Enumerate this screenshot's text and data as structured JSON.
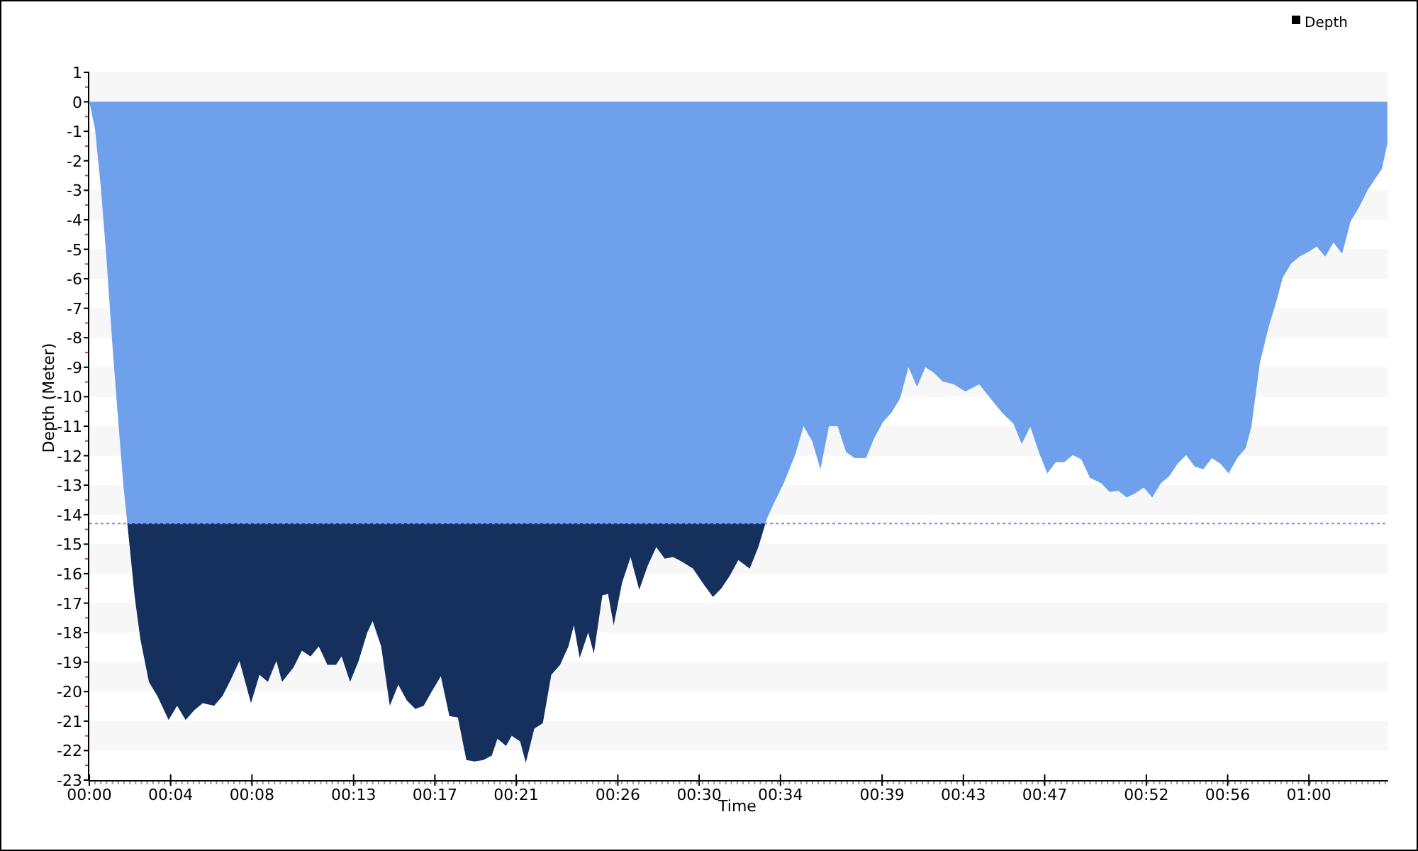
{
  "chart": {
    "chart_data": {
      "type": "area",
      "xlabel": "Time",
      "ylabel": "Depth (Meter)",
      "x": [
        0,
        0.28,
        0.56,
        0.84,
        1.12,
        1.39,
        1.67,
        1.95,
        2.23,
        2.51,
        2.93,
        3.35,
        3.9,
        4.32,
        4.74,
        5.16,
        5.58,
        6.14,
        6.55,
        6.97,
        7.39,
        7.95,
        8.37,
        8.78,
        9.2,
        9.48,
        10.04,
        10.46,
        10.88,
        11.29,
        11.71,
        12.13,
        12.41,
        12.83,
        13.25,
        13.67,
        13.94,
        14.36,
        14.78,
        15.2,
        15.62,
        16.04,
        16.45,
        16.87,
        17.29,
        17.71,
        18.13,
        18.55,
        18.96,
        19.38,
        19.8,
        20.08,
        20.5,
        20.78,
        21.19,
        21.47,
        21.89,
        22.31,
        22.73,
        23.15,
        23.57,
        23.84,
        24.12,
        24.54,
        24.82,
        25.24,
        25.52,
        25.8,
        26.21,
        26.63,
        27.05,
        27.47,
        27.89,
        28.31,
        28.72,
        29.14,
        29.7,
        30.26,
        30.68,
        31.09,
        31.51,
        31.93,
        32.49,
        32.91,
        33.33,
        33.74,
        34.16,
        34.72,
        35.14,
        35.56,
        35.97,
        36.39,
        36.81,
        37.23,
        37.65,
        38.21,
        38.62,
        39.04,
        39.46,
        39.88,
        40.3,
        40.72,
        41.13,
        41.55,
        41.97,
        42.53,
        43.09,
        43.78,
        44.34,
        44.9,
        45.46,
        45.87,
        46.29,
        46.71,
        47.13,
        47.55,
        47.97,
        48.38,
        48.8,
        49.22,
        49.78,
        50.2,
        50.62,
        51.03,
        51.45,
        51.87,
        52.29,
        52.71,
        53.13,
        53.54,
        53.96,
        54.38,
        54.8,
        55.22,
        55.64,
        56.05,
        56.47,
        56.89,
        57.17,
        57.59,
        58.01,
        58.43,
        58.7,
        59.12,
        59.54,
        59.96,
        60.38,
        60.8,
        61.21,
        61.63,
        62.05,
        62.47,
        62.89,
        63.31,
        63.59,
        63.86
      ],
      "series": [
        {
          "name": "Depth",
          "color": "#6fa0ec",
          "values": [
            0,
            -0.92,
            -2.85,
            -5.25,
            -8.13,
            -10.54,
            -12.94,
            -14.87,
            -16.79,
            -18.23,
            -19.67,
            -20.15,
            -20.96,
            -20.48,
            -20.96,
            -20.63,
            -20.39,
            -20.48,
            -20.15,
            -19.58,
            -18.96,
            -20.39,
            -19.43,
            -19.67,
            -18.96,
            -19.67,
            -19.19,
            -18.61,
            -18.81,
            -18.47,
            -19.09,
            -19.09,
            -18.81,
            -19.67,
            -18.96,
            -18.0,
            -17.61,
            -18.47,
            -20.48,
            -19.77,
            -20.3,
            -20.59,
            -20.48,
            -19.97,
            -19.48,
            -20.83,
            -20.88,
            -22.32,
            -22.37,
            -22.32,
            -22.17,
            -21.6,
            -21.84,
            -21.5,
            -21.69,
            -22.41,
            -21.26,
            -21.07,
            -19.43,
            -19.1,
            -18.47,
            -17.75,
            -18.86,
            -18.0,
            -18.71,
            -16.74,
            -16.69,
            -17.75,
            -16.31,
            -15.44,
            -16.55,
            -15.73,
            -15.1,
            -15.49,
            -15.44,
            -15.59,
            -15.83,
            -16.4,
            -16.79,
            -16.5,
            -16.07,
            -15.54,
            -15.83,
            -15.1,
            -14.14,
            -13.52,
            -12.94,
            -11.98,
            -11.0,
            -11.5,
            -12.46,
            -11.0,
            -11.0,
            -11.88,
            -12.08,
            -12.08,
            -11.4,
            -10.87,
            -10.54,
            -10.06,
            -9.0,
            -9.67,
            -9.0,
            -9.19,
            -9.48,
            -9.58,
            -9.82,
            -9.58,
            -10.06,
            -10.54,
            -10.92,
            -11.6,
            -11.02,
            -11.88,
            -12.6,
            -12.22,
            -12.22,
            -11.98,
            -12.12,
            -12.75,
            -12.94,
            -13.23,
            -13.19,
            -13.42,
            -13.28,
            -13.08,
            -13.42,
            -12.94,
            -12.7,
            -12.27,
            -11.98,
            -12.37,
            -12.46,
            -12.08,
            -12.27,
            -12.6,
            -12.08,
            -11.74,
            -11.02,
            -8.85,
            -7.65,
            -6.69,
            -5.97,
            -5.49,
            -5.25,
            -5.1,
            -4.91,
            -5.25,
            -4.77,
            -5.15,
            -4.05,
            -3.57,
            -2.99,
            -2.56,
            -2.27,
            -1.4
          ]
        }
      ],
      "xlim": [
        0,
        63.9
      ],
      "ylim": [
        -23,
        1
      ],
      "xticks": [
        {
          "value": 0,
          "label": "00:00"
        },
        {
          "value": 4,
          "label": "00:04"
        },
        {
          "value": 8,
          "label": "00:08"
        },
        {
          "value": 13,
          "label": "00:13"
        },
        {
          "value": 17,
          "label": "00:17"
        },
        {
          "value": 21,
          "label": "00:21"
        },
        {
          "value": 26,
          "label": "00:26"
        },
        {
          "value": 30,
          "label": "00:30"
        },
        {
          "value": 34,
          "label": "00:34"
        },
        {
          "value": 39,
          "label": "00:39"
        },
        {
          "value": 43,
          "label": "00:43"
        },
        {
          "value": 47,
          "label": "00:47"
        },
        {
          "value": 52,
          "label": "00:52"
        },
        {
          "value": 56,
          "label": "00:56"
        },
        {
          "value": 60,
          "label": "01:00"
        }
      ],
      "yticks": [
        1,
        0,
        -1,
        -2,
        -3,
        -4,
        -5,
        -6,
        -7,
        -8,
        -9,
        -10,
        -11,
        -12,
        -13,
        -14,
        -15,
        -16,
        -17,
        -18,
        -19,
        -20,
        -21,
        -22,
        -23
      ],
      "ref_lines": [
        {
          "axis": "y",
          "value": -14.3,
          "color": "#8080ff"
        }
      ]
    }
  }
}
